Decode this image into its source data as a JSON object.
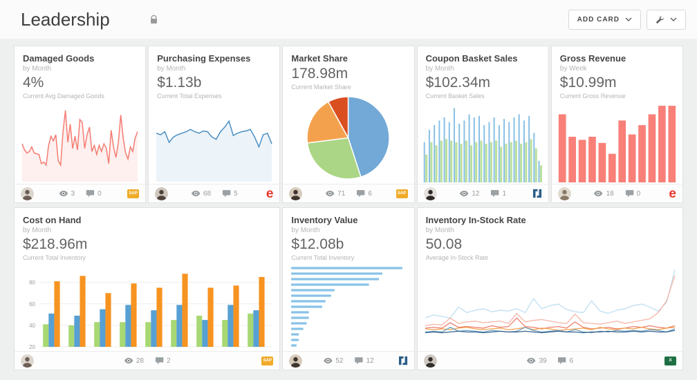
{
  "page": {
    "title": "Leadership"
  },
  "toolbar": {
    "add_card_label": "ADD CARD"
  },
  "badges": {
    "sap_bg": "#f0ab2a",
    "e_color": "#e8372c",
    "n_color": "#2a5d86",
    "excel_bg": "#1d6f42"
  },
  "cards": [
    {
      "title": "Damaged Goods",
      "subtitle": "by Month",
      "value": "4%",
      "value_label": "Current Avg Damaged Goods",
      "views": "3",
      "comments": "0",
      "badge_text": "SAP",
      "chart": {
        "type": "line",
        "color": "#f47c72",
        "fill": "#fdf0ef",
        "values": [
          48,
          40,
          36,
          38,
          44,
          36,
          35,
          34,
          22,
          24,
          20,
          46,
          58,
          52,
          60,
          26,
          20,
          64,
          92,
          50,
          74,
          42,
          58,
          40,
          80,
          76,
          42,
          60,
          70,
          38,
          46,
          34,
          46,
          38,
          48,
          42,
          22,
          66,
          44,
          30,
          50,
          86,
          56,
          36,
          28,
          44,
          38,
          56,
          64
        ]
      }
    },
    {
      "title": "Purchasing Expenses",
      "subtitle": "by Month",
      "value": "$1.13b",
      "value_label": "Current Total Expenses",
      "views": "68",
      "comments": "5",
      "badge_text": "e",
      "chart": {
        "type": "line",
        "color": "#4b8fc2",
        "fill": "#ecf3f9",
        "values": [
          62,
          60,
          64,
          50,
          57,
          60,
          62,
          64,
          67,
          64,
          62,
          65,
          64,
          57,
          54,
          64,
          70,
          78,
          59,
          62,
          64,
          65,
          67,
          57,
          44,
          60,
          62,
          48
        ]
      }
    },
    {
      "title": "Market Share",
      "subtitle": "",
      "value": "178.98m",
      "value_label": "Current Market Share",
      "views": "71",
      "comments": "6",
      "badge_text": "SAP",
      "chart": {
        "type": "pie",
        "values": [
          45,
          28,
          19,
          8
        ],
        "colors": [
          "#72a9d7",
          "#abd685",
          "#f4a14e",
          "#d94f20"
        ]
      }
    },
    {
      "title": "Coupon Basket Sales",
      "subtitle": "by Month",
      "value": "$102.34m",
      "value_label": "Current Basket Sales",
      "views": "12",
      "comments": "1",
      "chart": {
        "type": "paired_bar",
        "colors": [
          "#88c0e6",
          "#bce0a0"
        ],
        "series_a": [
          52,
          68,
          74,
          80,
          84,
          78,
          96,
          76,
          80,
          88,
          84,
          86,
          74,
          78,
          84,
          74,
          82,
          78,
          84,
          88,
          80,
          86,
          64,
          28
        ],
        "series_b": [
          36,
          52,
          48,
          54,
          56,
          54,
          52,
          50,
          54,
          48,
          52,
          54,
          50,
          52,
          54,
          46,
          50,
          52,
          54,
          50,
          52,
          56,
          44,
          22
        ]
      }
    },
    {
      "title": "Gross Revenue",
      "subtitle": "by Week",
      "value": "$10.99m",
      "value_label": "Current Gross Revenue",
      "views": "18",
      "comments": "0",
      "badge_text": "e",
      "chart": {
        "type": "bar",
        "color": "#f88078",
        "max": 10,
        "values": [
          8.8,
          5.9,
          5.5,
          5.9,
          5.1,
          3.7,
          8.0,
          6.2,
          7.4,
          8.8,
          9.9,
          9.9
        ]
      }
    },
    {
      "title": "Cost on Hand",
      "subtitle": "by Month",
      "value": "$218.96m",
      "value_label": "Current Total Inventory",
      "views": "28",
      "comments": "2",
      "badge_text": "SAP",
      "chart": {
        "type": "grouped_bar",
        "colors": [
          "#a8d873",
          "#57a0d3",
          "#f79320"
        ],
        "y_ticks": [
          20,
          40,
          60,
          80
        ],
        "y_min": 20,
        "y_max": 92,
        "series": [
          [
            41,
            40,
            43,
            43,
            43,
            45,
            49,
            45,
            51
          ],
          [
            51,
            49,
            55,
            59,
            54,
            59,
            45,
            59,
            54
          ],
          [
            81,
            86,
            70,
            79,
            75,
            88,
            75,
            77,
            85
          ]
        ]
      }
    },
    {
      "title": "Inventory Value",
      "subtitle": "by Month",
      "value": "$12.08b",
      "value_label": "Current Total Inventory",
      "views": "52",
      "comments": "12",
      "chart": {
        "type": "hbar",
        "color": "#88c2e8",
        "values": [
          100,
          82,
          79,
          70,
          39,
          36,
          31,
          28,
          16,
          16,
          14,
          11,
          7,
          7,
          5
        ]
      }
    },
    {
      "title": "Inventory In-Stock Rate",
      "subtitle": "by Month",
      "value": "50.08",
      "value_label": "Average In-Stock Rate",
      "views": "39",
      "comments": "6",
      "badge_text": "X",
      "chart": {
        "type": "multi_line",
        "y_max": 105,
        "series": [
          {
            "color": "#bedff2",
            "values": [
              38,
              42,
              40,
              38,
              52,
              45,
              48,
              50,
              46,
              48,
              47,
              50,
              45,
              63,
              50,
              54,
              56,
              49,
              46,
              45,
              60,
              47,
              44,
              48,
              50,
              54,
              56,
              52,
              47,
              58,
              100
            ]
          },
          {
            "color": "#f6b4a6",
            "values": [
              28,
              30,
              29,
              38,
              31,
              33,
              34,
              32,
              33,
              34,
              31,
              44,
              33,
              35,
              36,
              34,
              32,
              31,
              43,
              32,
              31,
              30,
              32,
              34,
              31,
              33,
              35,
              37,
              45,
              60,
              93
            ]
          },
          {
            "color": "#ec7f6d",
            "values": [
              25,
              26,
              25,
              32,
              26,
              27,
              26,
              25,
              28,
              26,
              27,
              38,
              27,
              26,
              24,
              26,
              27,
              25,
              33,
              26,
              24,
              25,
              26,
              24,
              25,
              27,
              26,
              28,
              26,
              25,
              28
            ]
          },
          {
            "color": "#f2a04c",
            "values": [
              24,
              23,
              24,
              23,
              25,
              26,
              24,
              23,
              24,
              25,
              23,
              24,
              26,
              23,
              25,
              24,
              22,
              23,
              24,
              25,
              23,
              26,
              24,
              23,
              25,
              24,
              26,
              24,
              23,
              25,
              26
            ]
          },
          {
            "color": "#6fa0c2",
            "values": [
              20,
              21,
              20,
              26,
              21,
              22,
              21,
              20,
              22,
              21,
              20,
              21,
              26,
              22,
              20,
              21,
              22,
              20,
              23,
              20,
              19,
              21,
              20,
              22,
              21,
              22,
              21,
              23,
              22,
              20,
              24
            ]
          },
          {
            "color": "#33618e",
            "values": [
              19,
              20,
              19,
              20,
              21,
              20,
              20,
              19,
              20,
              21,
              20,
              20,
              21,
              20,
              19,
              20,
              21,
              20,
              20,
              19,
              20,
              20,
              21,
              20,
              20,
              21,
              20,
              21,
              20,
              20,
              22
            ]
          }
        ]
      }
    }
  ]
}
